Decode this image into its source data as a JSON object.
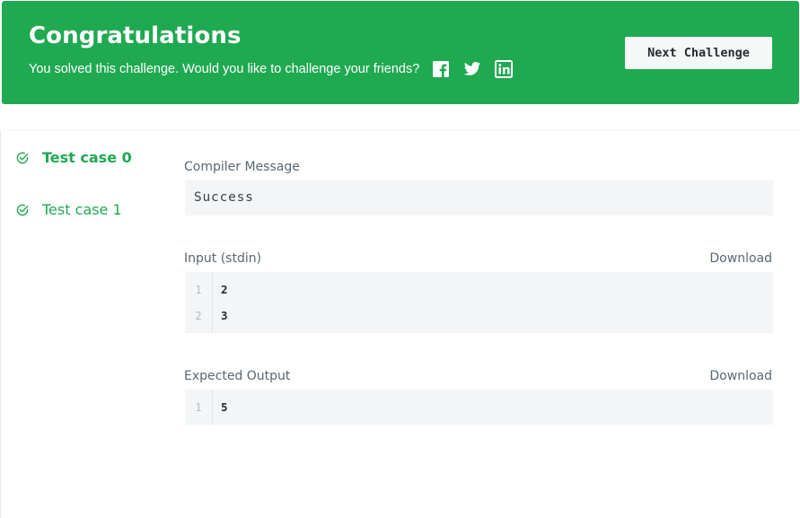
{
  "banner": {
    "title": "Congratulations",
    "subtitle": "You solved this challenge. Would you like to challenge your friends?",
    "share_icons": [
      "facebook-icon",
      "twitter-icon",
      "linkedin-icon"
    ],
    "next_button_label": "Next Challenge",
    "background_color": "#1fa951"
  },
  "test_cases": [
    {
      "label": "Test case 0",
      "status": "passed",
      "active": true
    },
    {
      "label": "Test case 1",
      "status": "passed",
      "active": false
    }
  ],
  "compiler": {
    "label": "Compiler Message",
    "message": "Success"
  },
  "input": {
    "label": "Input (stdin)",
    "download_label": "Download",
    "lines": [
      {
        "number": "1",
        "text": "2"
      },
      {
        "number": "2",
        "text": "3"
      }
    ]
  },
  "expected_output": {
    "label": "Expected Output",
    "download_label": "Download",
    "lines": [
      {
        "number": "1",
        "text": "5"
      }
    ]
  },
  "colors": {
    "accent": "#1fa951",
    "code_bg": "#f3f5f6",
    "muted_text": "#576871"
  }
}
